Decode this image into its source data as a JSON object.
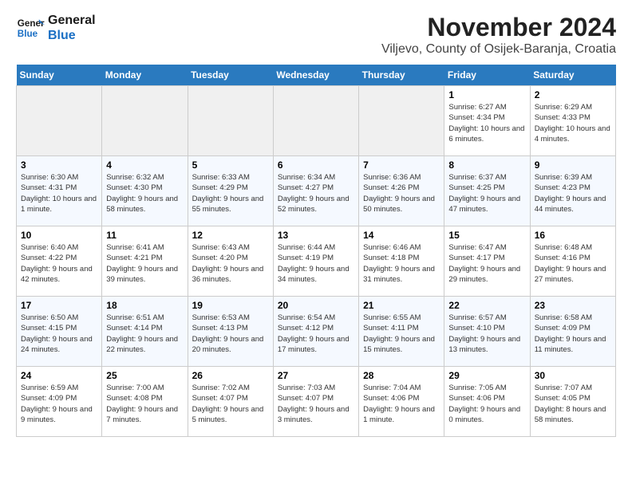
{
  "header": {
    "logo_line1": "General",
    "logo_line2": "Blue",
    "month_title": "November 2024",
    "location": "Viljevo, County of Osijek-Baranja, Croatia"
  },
  "weekdays": [
    "Sunday",
    "Monday",
    "Tuesday",
    "Wednesday",
    "Thursday",
    "Friday",
    "Saturday"
  ],
  "weeks": [
    [
      {
        "day": "",
        "info": ""
      },
      {
        "day": "",
        "info": ""
      },
      {
        "day": "",
        "info": ""
      },
      {
        "day": "",
        "info": ""
      },
      {
        "day": "",
        "info": ""
      },
      {
        "day": "1",
        "info": "Sunrise: 6:27 AM\nSunset: 4:34 PM\nDaylight: 10 hours and 6 minutes."
      },
      {
        "day": "2",
        "info": "Sunrise: 6:29 AM\nSunset: 4:33 PM\nDaylight: 10 hours and 4 minutes."
      }
    ],
    [
      {
        "day": "3",
        "info": "Sunrise: 6:30 AM\nSunset: 4:31 PM\nDaylight: 10 hours and 1 minute."
      },
      {
        "day": "4",
        "info": "Sunrise: 6:32 AM\nSunset: 4:30 PM\nDaylight: 9 hours and 58 minutes."
      },
      {
        "day": "5",
        "info": "Sunrise: 6:33 AM\nSunset: 4:29 PM\nDaylight: 9 hours and 55 minutes."
      },
      {
        "day": "6",
        "info": "Sunrise: 6:34 AM\nSunset: 4:27 PM\nDaylight: 9 hours and 52 minutes."
      },
      {
        "day": "7",
        "info": "Sunrise: 6:36 AM\nSunset: 4:26 PM\nDaylight: 9 hours and 50 minutes."
      },
      {
        "day": "8",
        "info": "Sunrise: 6:37 AM\nSunset: 4:25 PM\nDaylight: 9 hours and 47 minutes."
      },
      {
        "day": "9",
        "info": "Sunrise: 6:39 AM\nSunset: 4:23 PM\nDaylight: 9 hours and 44 minutes."
      }
    ],
    [
      {
        "day": "10",
        "info": "Sunrise: 6:40 AM\nSunset: 4:22 PM\nDaylight: 9 hours and 42 minutes."
      },
      {
        "day": "11",
        "info": "Sunrise: 6:41 AM\nSunset: 4:21 PM\nDaylight: 9 hours and 39 minutes."
      },
      {
        "day": "12",
        "info": "Sunrise: 6:43 AM\nSunset: 4:20 PM\nDaylight: 9 hours and 36 minutes."
      },
      {
        "day": "13",
        "info": "Sunrise: 6:44 AM\nSunset: 4:19 PM\nDaylight: 9 hours and 34 minutes."
      },
      {
        "day": "14",
        "info": "Sunrise: 6:46 AM\nSunset: 4:18 PM\nDaylight: 9 hours and 31 minutes."
      },
      {
        "day": "15",
        "info": "Sunrise: 6:47 AM\nSunset: 4:17 PM\nDaylight: 9 hours and 29 minutes."
      },
      {
        "day": "16",
        "info": "Sunrise: 6:48 AM\nSunset: 4:16 PM\nDaylight: 9 hours and 27 minutes."
      }
    ],
    [
      {
        "day": "17",
        "info": "Sunrise: 6:50 AM\nSunset: 4:15 PM\nDaylight: 9 hours and 24 minutes."
      },
      {
        "day": "18",
        "info": "Sunrise: 6:51 AM\nSunset: 4:14 PM\nDaylight: 9 hours and 22 minutes."
      },
      {
        "day": "19",
        "info": "Sunrise: 6:53 AM\nSunset: 4:13 PM\nDaylight: 9 hours and 20 minutes."
      },
      {
        "day": "20",
        "info": "Sunrise: 6:54 AM\nSunset: 4:12 PM\nDaylight: 9 hours and 17 minutes."
      },
      {
        "day": "21",
        "info": "Sunrise: 6:55 AM\nSunset: 4:11 PM\nDaylight: 9 hours and 15 minutes."
      },
      {
        "day": "22",
        "info": "Sunrise: 6:57 AM\nSunset: 4:10 PM\nDaylight: 9 hours and 13 minutes."
      },
      {
        "day": "23",
        "info": "Sunrise: 6:58 AM\nSunset: 4:09 PM\nDaylight: 9 hours and 11 minutes."
      }
    ],
    [
      {
        "day": "24",
        "info": "Sunrise: 6:59 AM\nSunset: 4:09 PM\nDaylight: 9 hours and 9 minutes."
      },
      {
        "day": "25",
        "info": "Sunrise: 7:00 AM\nSunset: 4:08 PM\nDaylight: 9 hours and 7 minutes."
      },
      {
        "day": "26",
        "info": "Sunrise: 7:02 AM\nSunset: 4:07 PM\nDaylight: 9 hours and 5 minutes."
      },
      {
        "day": "27",
        "info": "Sunrise: 7:03 AM\nSunset: 4:07 PM\nDaylight: 9 hours and 3 minutes."
      },
      {
        "day": "28",
        "info": "Sunrise: 7:04 AM\nSunset: 4:06 PM\nDaylight: 9 hours and 1 minute."
      },
      {
        "day": "29",
        "info": "Sunrise: 7:05 AM\nSunset: 4:06 PM\nDaylight: 9 hours and 0 minutes."
      },
      {
        "day": "30",
        "info": "Sunrise: 7:07 AM\nSunset: 4:05 PM\nDaylight: 8 hours and 58 minutes."
      }
    ]
  ]
}
